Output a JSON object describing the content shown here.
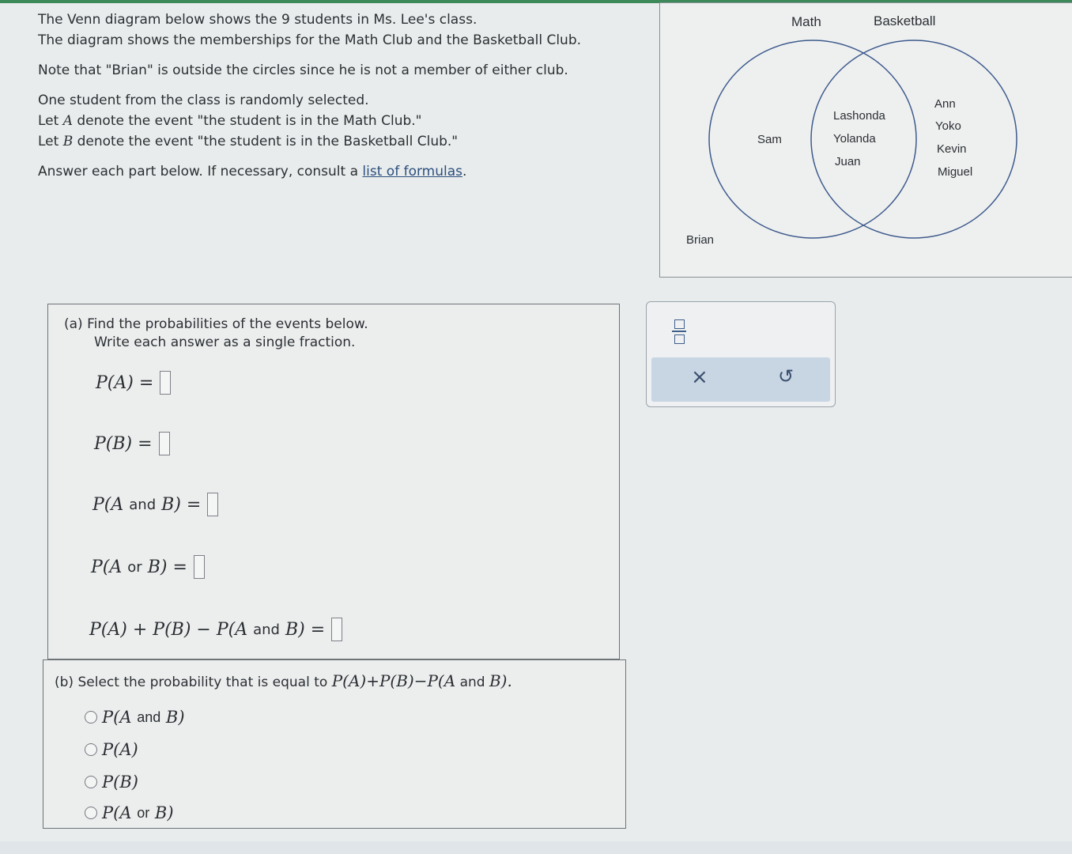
{
  "intro": {
    "line1": "The Venn diagram below shows the 9 students in Ms. Lee's class.",
    "line2": "The diagram shows the memberships for the Math Club and the Basketball Club.",
    "line3": "Note that \"Brian\" is outside the circles since he is not a member of either club.",
    "line4": "One student from the class is randomly selected.",
    "line5_pre": "Let ",
    "line5_var": "A",
    "line5_post": " denote the event \"the student is in the Math Club.\"",
    "line6_pre": "Let ",
    "line6_var": "B",
    "line6_post": " denote the event \"the student is in the Basketball Club.\"",
    "line7_pre": "Answer each part below. If necessary, consult a ",
    "line7_link": "list of formulas",
    "line7_post": "."
  },
  "venn": {
    "label_math": "Math",
    "label_basketball": "Basketball",
    "only_math": [
      "Sam"
    ],
    "both": [
      "Lashonda",
      "Yolanda",
      "Juan"
    ],
    "only_basketball": [
      "Ann",
      "Yoko",
      "Kevin",
      "Miguel"
    ],
    "outside": [
      "Brian"
    ],
    "circle_color": "#3e5a8c"
  },
  "part_a": {
    "label": "(a)",
    "instruction1": "Find the probabilities of the events below.",
    "instruction2": "Write each answer as a single fraction.",
    "eq1": "P(A) =",
    "eq2": "P(B) =",
    "eq3_a": "P(A",
    "eq3_and": "and",
    "eq3_b": "B) =",
    "eq4_a": "P(A",
    "eq4_or": "or",
    "eq4_b": "B) =",
    "eq5_a": "P(A) + P(B) − P(A",
    "eq5_and": "and",
    "eq5_b": "B) ="
  },
  "part_b": {
    "label": "(b)",
    "question_pre": "Select the probability that is equal to ",
    "question_math": "P(A)+P(B)−P(A",
    "question_and": "and",
    "question_end": "B).",
    "options": [
      {
        "a": "P(A",
        "word": "and",
        "b": "B)"
      },
      {
        "a": "P(A)",
        "word": "",
        "b": ""
      },
      {
        "a": "P(B)",
        "word": "",
        "b": ""
      },
      {
        "a": "P(A",
        "word": "or",
        "b": "B)"
      }
    ]
  },
  "toolbox": {
    "clear_symbol": "×",
    "undo_symbol": "↺"
  }
}
